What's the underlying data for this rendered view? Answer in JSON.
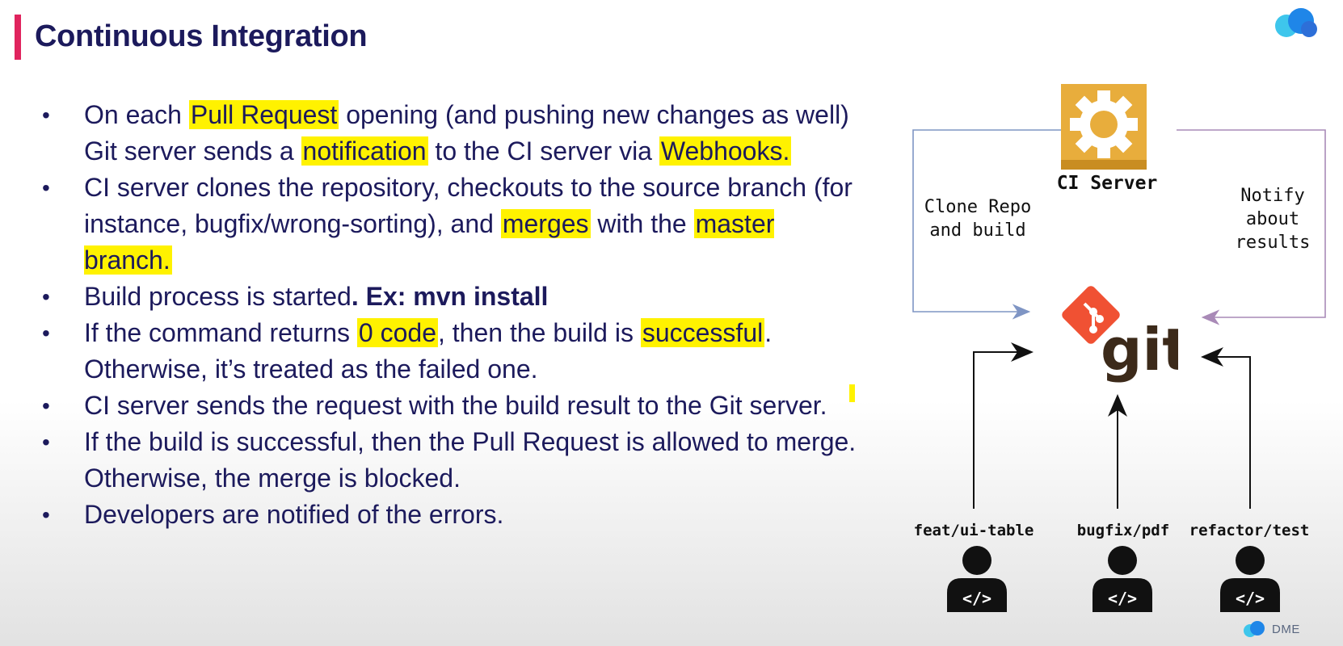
{
  "slide": {
    "title": "Continuous Integration"
  },
  "bullets": [
    {
      "segments": [
        {
          "text": "On each ",
          "style": ""
        },
        {
          "text": "Pull Request",
          "style": "hl"
        },
        {
          "text": " opening (and pushing new changes as well) Git server sends a ",
          "style": ""
        },
        {
          "text": "notification",
          "style": "hl"
        },
        {
          "text": " to the CI server via ",
          "style": ""
        },
        {
          "text": "Webhooks.",
          "style": "hl"
        }
      ]
    },
    {
      "segments": [
        {
          "text": "CI server clones the repository, checkouts to the source branch (for instance, bugfix/wrong-sorting), and ",
          "style": ""
        },
        {
          "text": "merges",
          "style": "hl"
        },
        {
          "text": " with the ",
          "style": ""
        },
        {
          "text": "master branch.",
          "style": "hl"
        }
      ]
    },
    {
      "segments": [
        {
          "text": "Build process is started",
          "style": ""
        },
        {
          "text": ". Ex: mvn install",
          "style": "bold"
        }
      ]
    },
    {
      "segments": [
        {
          "text": "If the command returns ",
          "style": ""
        },
        {
          "text": "0 code",
          "style": "hl"
        },
        {
          "text": ", then the build is ",
          "style": ""
        },
        {
          "text": "successful",
          "style": "hl"
        },
        {
          "text": ". Otherwise, it’s treated as the failed one.",
          "style": ""
        }
      ]
    },
    {
      "segments": [
        {
          "text": "CI server sends the request with the build result to the Git server.",
          "style": ""
        }
      ]
    },
    {
      "segments": [
        {
          "text": "If the build is successful, then the Pull Request is allowed to merge. Otherwise, the merge is blocked.",
          "style": ""
        }
      ]
    },
    {
      "segments": [
        {
          "text": "Developers are notified of the errors.",
          "style": ""
        }
      ]
    }
  ],
  "diagram": {
    "ci_server_label": "CI Server",
    "clone_label": [
      "Clone Repo",
      "and build"
    ],
    "notify_label": [
      "Notify",
      "about",
      "results"
    ],
    "git_label": "git",
    "developers": [
      {
        "branch": "feat/ui-table"
      },
      {
        "branch": "bugfix/pdf"
      },
      {
        "branch": "refactor/test"
      }
    ]
  },
  "icons": {
    "ci_server": "gear-icon",
    "git": "git-logo-icon",
    "developer": "developer-avatar-icon",
    "brand": "brand-logo-icon"
  },
  "colors": {
    "title_accent": "#e0245e",
    "highlight": "#fff200",
    "text": "#1c1a5c",
    "ci_server_tile": "#e8ad3c",
    "git_orange": "#f05133",
    "git_dark": "#3c2a1a",
    "line_clone": "#7f95c4",
    "line_notify": "#a98ab7"
  },
  "brand": {
    "footer_text": "DME"
  }
}
